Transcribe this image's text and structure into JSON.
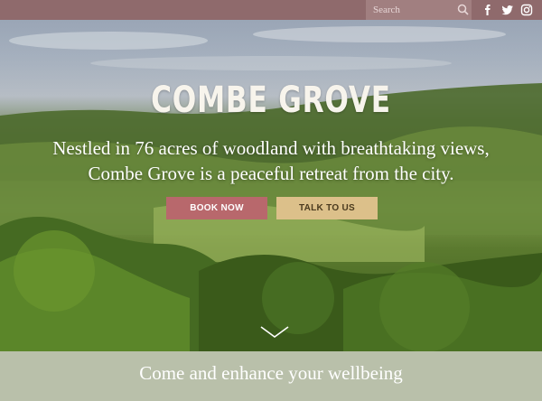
{
  "topbar": {
    "search_placeholder": "Search",
    "social_icons": [
      "facebook-icon",
      "twitter-icon",
      "instagram-icon"
    ]
  },
  "hero": {
    "title": "COMBE GROVE",
    "tagline_line1": "Nestled in 76 acres of woodland with breathtaking views,",
    "tagline_line2": "Combe Grove is a peaceful retreat from the city.",
    "book_label": "BOOK NOW",
    "talk_label": "TALK TO US",
    "scroll_icon": "chevron-down-icon"
  },
  "band": {
    "text": "Come and enhance your wellbeing"
  },
  "colors": {
    "topbar": "#8f6a6c",
    "search_bg": "#a17f80",
    "book_button": "#b8686c",
    "talk_button": "#dcc08a",
    "band": "#b9c0aa"
  }
}
